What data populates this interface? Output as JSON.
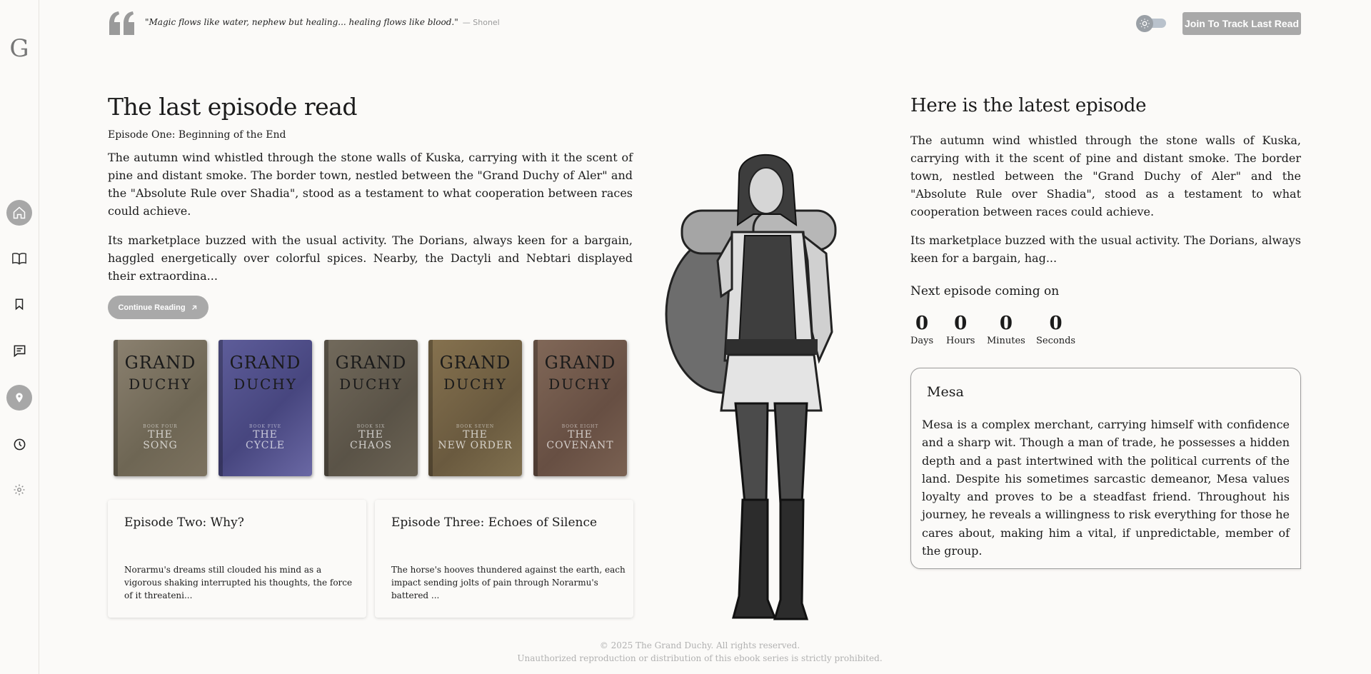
{
  "sidebar": {
    "logo": "G",
    "items": [
      {
        "name": "home",
        "icon": "home-icon"
      },
      {
        "name": "library",
        "icon": "book-open-icon"
      },
      {
        "name": "bookmarks",
        "icon": "bookmark-icon"
      },
      {
        "name": "comments",
        "icon": "comment-icon"
      },
      {
        "name": "map",
        "icon": "location-pin-icon"
      },
      {
        "name": "history",
        "icon": "clock-icon"
      },
      {
        "name": "settings",
        "icon": "gear-icon"
      }
    ]
  },
  "header": {
    "quote": "\"Magic flows like water, nephew but healing... healing flows like blood.\"",
    "quote_author": "— Shonel",
    "join_label": "Join To Track Last Read"
  },
  "last_read": {
    "heading": "The last episode read",
    "episode_title": "Episode One: Beginning of the End",
    "para1": "The autumn wind whistled through the stone walls of Kuska, carrying with it the scent of pine and distant smoke. The border town, nestled between the \"Grand Duchy of Aler\" and the \"Absolute Rule over Shadia\", stood as a testament to what cooperation between races could achieve.",
    "para2": "Its marketplace buzzed with the usual activity. The Dorians, always keen for a bargain, haggled energetically over colorful spices. Nearby, the Dactyli and Nebtari displayed their extraordina...",
    "continue_label": "Continue Reading"
  },
  "books": [
    {
      "series_l1": "GRAND",
      "series_l2": "DUCHY",
      "volume": "BOOK FOUR",
      "name_l1": "THE",
      "name_l2": "SONG",
      "color": "#7f7563"
    },
    {
      "series_l1": "GRAND",
      "series_l2": "DUCHY",
      "volume": "BOOK FIVE",
      "name_l1": "THE",
      "name_l2": "CYCLE",
      "color": "#5b5a93"
    },
    {
      "series_l1": "GRAND",
      "series_l2": "DUCHY",
      "volume": "BOOK SIX",
      "name_l1": "THE",
      "name_l2": "CHAOS",
      "color": "#6b6253"
    },
    {
      "series_l1": "GRAND",
      "series_l2": "DUCHY",
      "volume": "BOOK SEVEN",
      "name_l1": "THE",
      "name_l2": "NEW ORDER",
      "color": "#7d6a4e"
    },
    {
      "series_l1": "GRAND",
      "series_l2": "DUCHY",
      "volume": "BOOK EIGHT",
      "name_l1": "THE",
      "name_l2": "COVENANT",
      "color": "#7a6153"
    }
  ],
  "episodes": [
    {
      "title": "Episode Two: Why?",
      "excerpt": "Norarmu's dreams still clouded his mind as a vigorous shaking interrupted his thoughts, the force of it threateni..."
    },
    {
      "title": "Episode Three: Echoes of Silence",
      "excerpt": "The horse's hooves thundered against the earth, each impact sending jolts of pain through Norarmu's battered ..."
    }
  ],
  "latest": {
    "heading": "Here is the latest episode",
    "para1": "The autumn wind whistled through the stone walls of Kuska, carrying with it the scent of pine and distant smoke. The border town, nestled between the \"Grand Duchy of Aler\" and the \"Absolute Rule over Shadia\", stood as a testament to what cooperation between races could achieve.",
    "para2": "Its marketplace buzzed with the usual activity. The Dorians, always keen for a bargain, hag..."
  },
  "countdown": {
    "label": "Next episode coming on",
    "days": "0",
    "days_label": "Days",
    "hours": "0",
    "hours_label": "Hours",
    "minutes": "0",
    "minutes_label": "Minutes",
    "seconds": "0",
    "seconds_label": "Seconds"
  },
  "character": {
    "name": "Mesa",
    "description": "Mesa is a complex merchant, carrying himself with confidence and a sharp wit. Though a man of trade, he possesses a hidden depth and a past intertwined with the political currents of the land. Despite his sometimes sarcastic demeanor, Mesa values loyalty and proves to be a steadfast friend. Throughout his journey, he reveals a willingness to risk everything for those he cares about, making him a vital, if unpredictable, member of the group."
  },
  "footer": {
    "copyright": "© 2025 The Grand Duchy. All rights reserved.",
    "notice": "Unauthorized reproduction or distribution of this ebook series is strictly prohibited."
  }
}
